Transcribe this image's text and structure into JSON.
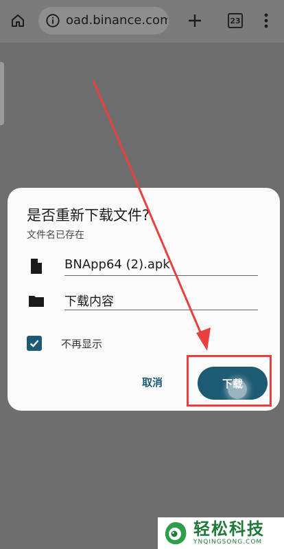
{
  "browser": {
    "url": "oad.binance.com",
    "tab_count": "23"
  },
  "dialog": {
    "title": "是否重新下载文件?",
    "subtitle": "文件名已存在",
    "file_name": "BNApp64 (2).apk",
    "folder_name": "下载内容",
    "checkbox_label": "不再显示",
    "checkbox_checked": true,
    "cancel_label": "取消",
    "download_label": "下载"
  },
  "watermark": {
    "cn": "轻松科技",
    "en": "YNQINGSONG.COM"
  },
  "colors": {
    "accent": "#1d5a73",
    "annotation": "#e8403e",
    "brand": "#1f7a3a"
  }
}
